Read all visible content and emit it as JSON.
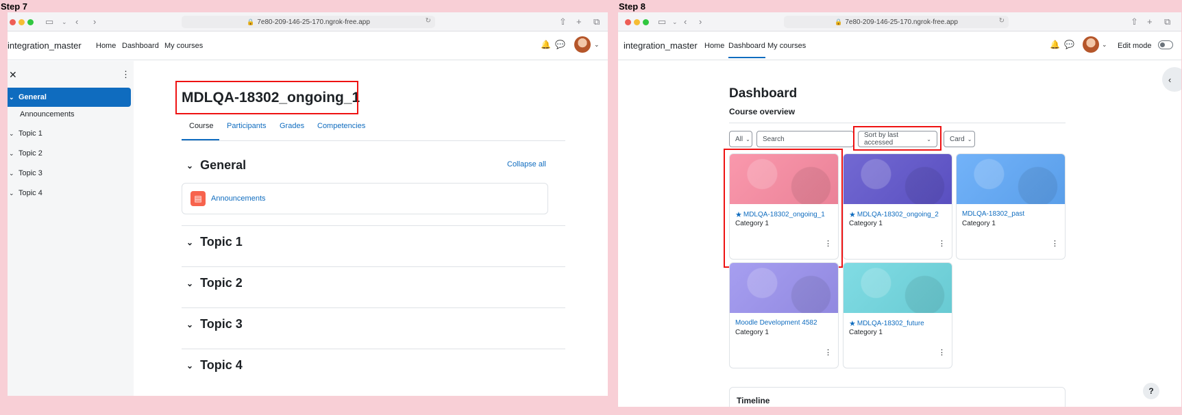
{
  "steps": [
    "Step 7",
    "Step 8"
  ],
  "browser": {
    "url": "7e80-209-146-25-170.ngrok-free.app"
  },
  "site": {
    "brand": "integration_master",
    "nav": [
      "Home",
      "Dashboard",
      "My courses"
    ]
  },
  "step7": {
    "drawer": {
      "items": [
        "General",
        "Topic 1",
        "Topic 2",
        "Topic 3",
        "Topic 4"
      ],
      "sub": "Announcements"
    },
    "course_title": "MDLQA-18302_ongoing_1",
    "tabs": [
      "Course",
      "Participants",
      "Grades",
      "Competencies"
    ],
    "collapse_all": "Collapse all",
    "sections": [
      "General",
      "Topic 1",
      "Topic 2",
      "Topic 3",
      "Topic 4"
    ],
    "activity": "Announcements"
  },
  "step8": {
    "edit_mode": "Edit mode",
    "dashboard_title": "Dashboard",
    "course_overview": "Course overview",
    "filter_all": "All",
    "search_placeholder": "Search",
    "sort_label": "Sort by last accessed",
    "view_label": "Card",
    "cards": [
      {
        "name": "MDLQA-18302_ongoing_1",
        "category": "Category 1",
        "starred": true,
        "color": "#f98aa1"
      },
      {
        "name": "MDLQA-18302_ongoing_2",
        "category": "Category 1",
        "starred": true,
        "color": "#5f54cc"
      },
      {
        "name": "MDLQA-18302_past",
        "category": "Category 1",
        "starred": false,
        "color": "#5fa8f8"
      },
      {
        "name": "Moodle Development 4582",
        "category": "Category 1",
        "starred": false,
        "color": "#9a91ee"
      },
      {
        "name": "MDLQA-18302_future",
        "category": "Category 1",
        "starred": true,
        "color": "#6fd7e0"
      }
    ],
    "timeline": "Timeline",
    "help": "?"
  }
}
